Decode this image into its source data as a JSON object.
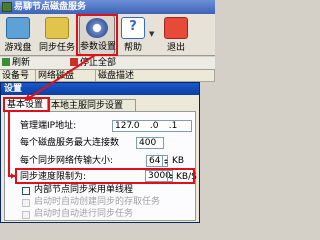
{
  "main_window": {
    "title": "易聊节点磁盘服务"
  },
  "toolbar": {
    "buttons": [
      {
        "id": "mode",
        "label": "游戏盘"
      },
      {
        "id": "sync",
        "label": "同步任务"
      },
      {
        "id": "params",
        "label": "参数设置"
      },
      {
        "id": "help",
        "label": "帮助",
        "glyph": "?"
      },
      {
        "id": "exit",
        "label": "退出"
      }
    ]
  },
  "toolbar2": {
    "items": [
      {
        "label": "刷新"
      },
      {
        "label": "停止全部"
      }
    ]
  },
  "list": {
    "columns": [
      "设备号",
      "网络磁盘",
      "磁盘描述"
    ]
  },
  "dialog": {
    "title": "设置",
    "tabs": [
      "基本设置",
      "本地主服同步设置"
    ],
    "fields": {
      "ip_label": "管理端IP地址:",
      "ip": [
        "127",
        "0",
        "0",
        "1"
      ],
      "max_conn_label": "每个磁盘服务最大连接数",
      "max_conn": "400",
      "bandwidth_label": "每个同步网络传输大小:",
      "bandwidth": "64",
      "bandwidth_unit": "KB",
      "speed_label": "同步速度限制为:",
      "speed": "3000",
      "speed_unit": "KB/S",
      "checkbox_fs_label": "内部节点同步采用单线程",
      "checkbox_boot_label": "启动时自动创建同步的存取任务",
      "checkbox_sync_label": "启动时自动进行同步任务"
    }
  },
  "annotation_color": "#e0101a"
}
